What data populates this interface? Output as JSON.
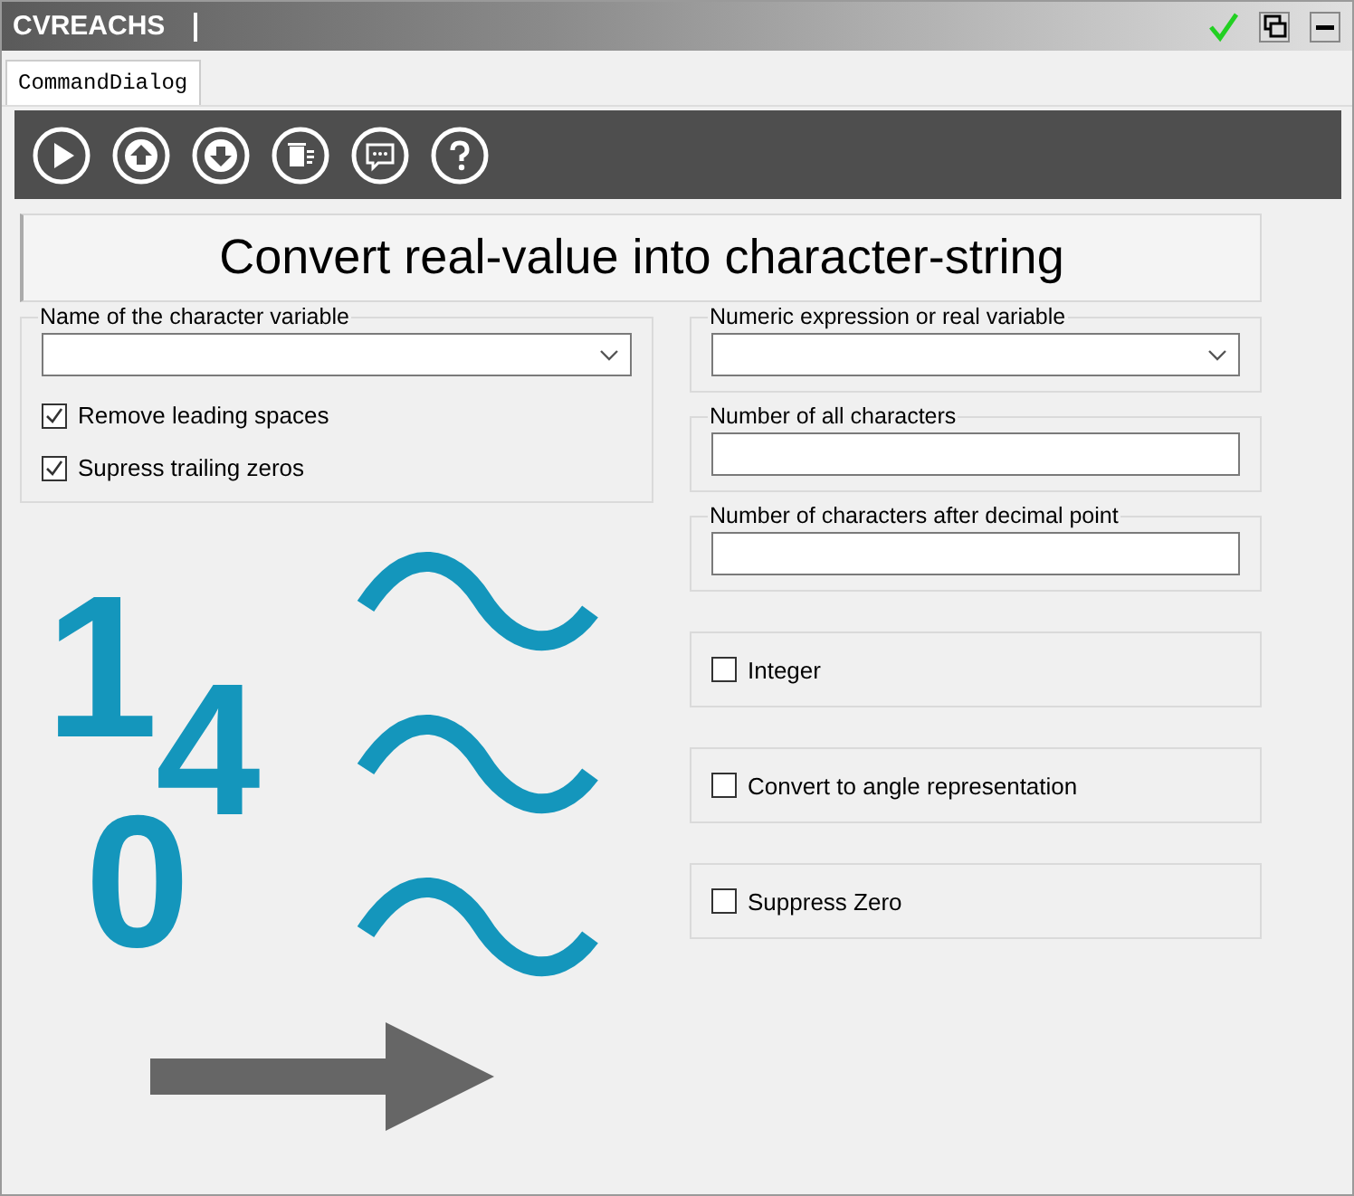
{
  "window": {
    "title": "CVREACHS"
  },
  "tabs": [
    {
      "label": "CommandDialog",
      "selected": true
    }
  ],
  "toolbar": [
    {
      "kind": "play"
    },
    {
      "kind": "up"
    },
    {
      "kind": "down"
    },
    {
      "kind": "delete"
    },
    {
      "kind": "comment"
    },
    {
      "kind": "help"
    }
  ],
  "heading": "Convert real-value into character-string",
  "left_group": {
    "label": "Name of the character variable",
    "field": {
      "kind": "dropdown"
    },
    "checkboxes": [
      {
        "label": "Remove leading spaces",
        "checked": true
      },
      {
        "label": "Supress trailing zeros",
        "checked": true
      }
    ]
  },
  "right_groups": [
    {
      "kind": "dropdown",
      "label": "Numeric expression or real variable"
    },
    {
      "kind": "input",
      "label": "Number of all characters"
    },
    {
      "kind": "input",
      "label": "Number of characters after decimal point"
    },
    {
      "kind": "checkbox",
      "label": "Integer",
      "checked": false
    },
    {
      "kind": "checkbox",
      "label": "Convert to angle representation",
      "checked": false
    },
    {
      "kind": "checkbox",
      "label": "Suppress Zero",
      "checked": false
    }
  ],
  "illustration": {
    "digits": [
      "1",
      "4",
      "0"
    ]
  }
}
